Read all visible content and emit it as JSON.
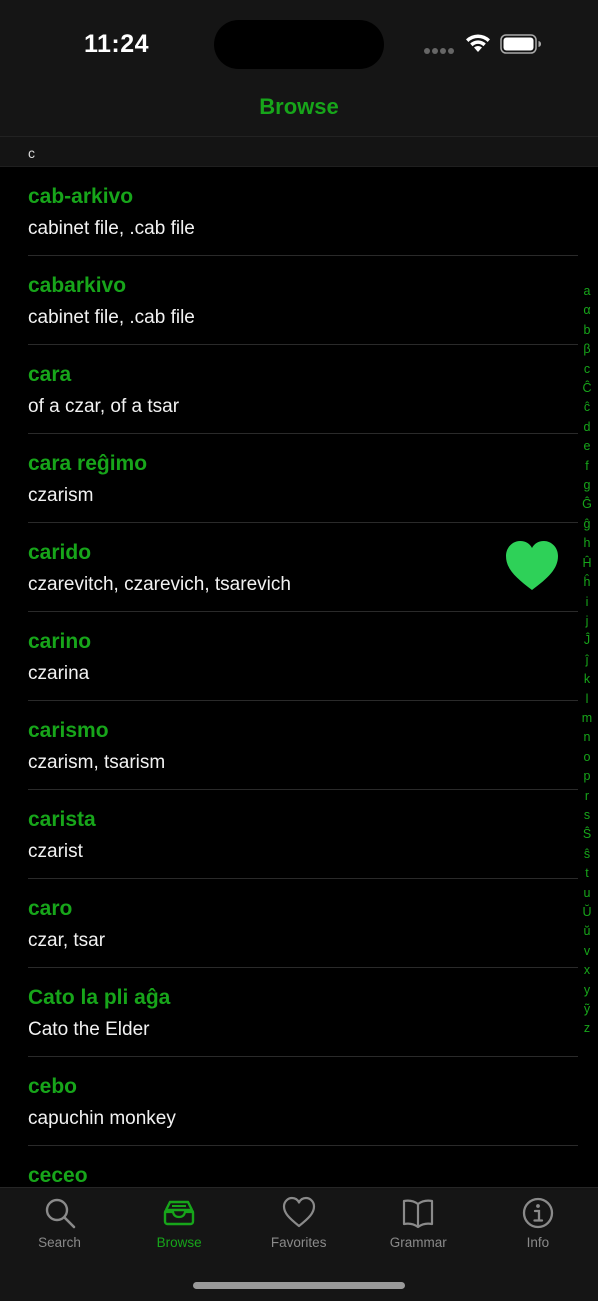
{
  "status_bar": {
    "time": "11:24"
  },
  "nav": {
    "title": "Browse"
  },
  "section": {
    "header": "c"
  },
  "entries": [
    {
      "term": "cab-arkivo",
      "definition": "cabinet file, .cab file"
    },
    {
      "term": "cabarkivo",
      "definition": "cabinet file, .cab file"
    },
    {
      "term": "cara",
      "definition": "of a czar, of a tsar"
    },
    {
      "term": "cara reĝimo",
      "definition": "czarism"
    },
    {
      "term": "carido",
      "definition": "czarevitch, czarevich, tsarevich",
      "favorite": true
    },
    {
      "term": "carino",
      "definition": "czarina"
    },
    {
      "term": "carismo",
      "definition": "czarism, tsarism"
    },
    {
      "term": "carista",
      "definition": "czarist"
    },
    {
      "term": "caro",
      "definition": "czar, tsar"
    },
    {
      "term": "Cato la pli aĝa",
      "definition": "Cato the Elder"
    },
    {
      "term": "cebo",
      "definition": "capuchin monkey"
    },
    {
      "term": "ceceo",
      "definition": ""
    }
  ],
  "index_letters": [
    "a",
    "α",
    "b",
    "β",
    "c",
    "Ĉ",
    "ĉ",
    "d",
    "e",
    "f",
    "g",
    "Ĝ",
    "ĝ",
    "h",
    "Ĥ",
    "ĥ",
    "i",
    "j",
    "Ĵ",
    "ĵ",
    "k",
    "l",
    "m",
    "n",
    "o",
    "p",
    "r",
    "s",
    "Ŝ",
    "ŝ",
    "t",
    "u",
    "Ŭ",
    "ŭ",
    "v",
    "x",
    "y",
    "ỹ",
    "z"
  ],
  "tabs": [
    {
      "label": "Search",
      "icon": "magnifier-icon",
      "active": false
    },
    {
      "label": "Browse",
      "icon": "tray-icon",
      "active": true
    },
    {
      "label": "Favorites",
      "icon": "heart-icon",
      "active": false
    },
    {
      "label": "Grammar",
      "icon": "book-icon",
      "active": false
    },
    {
      "label": "Info",
      "icon": "info-icon",
      "active": false
    }
  ],
  "colors": {
    "accent": "#17a51a",
    "favorite": "#2ed158",
    "background": "#000000",
    "bar_background": "#151515",
    "inactive": "#8a8a8a"
  }
}
